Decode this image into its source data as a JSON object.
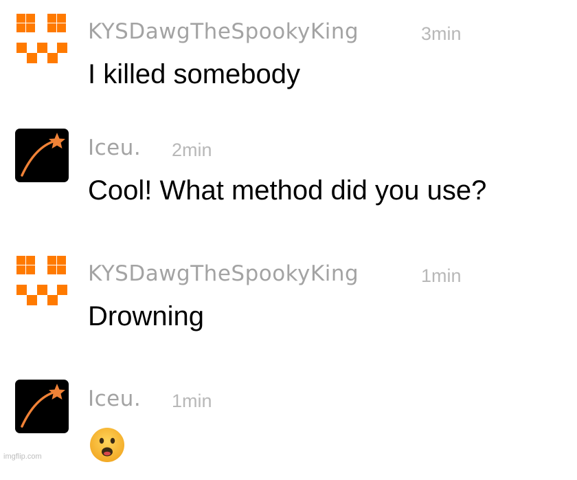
{
  "colors": {
    "username": "#a3a3a3",
    "timestamp": "#b8b8b8",
    "message_text": "#000000",
    "checker_orange": "#ff7a00",
    "star_icon_bg": "#000000",
    "star_icon_accent": "#f08237",
    "emoji_face": "#f7b93e"
  },
  "messages": [
    {
      "username": "KYSDawgTheSpookyKing",
      "time": "3min",
      "text": "I killed somebody",
      "avatar_icon": "orange-checker-avatar-icon"
    },
    {
      "username": "Iceu.",
      "time": "2min",
      "text": "Cool! What method did you use?",
      "avatar_icon": "shooting-star-avatar-icon"
    },
    {
      "username": "KYSDawgTheSpookyKing",
      "time": "1min",
      "text": "Drowning",
      "avatar_icon": "orange-checker-avatar-icon"
    },
    {
      "username": "Iceu.",
      "time": "1min",
      "emoji": "frowning-face-open-mouth-emoji",
      "avatar_icon": "shooting-star-avatar-icon"
    }
  ],
  "watermark": "imgflip.com"
}
